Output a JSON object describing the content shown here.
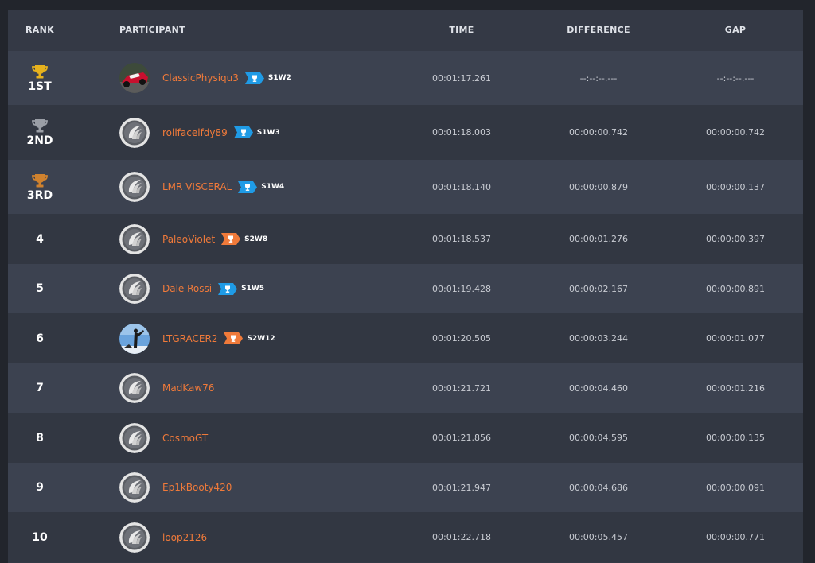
{
  "colors": {
    "accent_orange": "#f07a3a",
    "badge_blue": "#1f9be6",
    "badge_orange": "#f07a3a",
    "gold": "#e7b21d",
    "silver": "#9a9ea6",
    "bronze": "#d0822e"
  },
  "headers": {
    "rank": "RANK",
    "participant": "PARTICIPANT",
    "time": "TIME",
    "difference": "DIFFERENCE",
    "gap": "GAP"
  },
  "rows": [
    {
      "rank": "1ST",
      "trophy": "gold",
      "name": "ClassicPhysiqu3",
      "avatar": "race-car-avatar",
      "badge": "blue",
      "badge_label": "S1W2",
      "time": "00:01:17.261",
      "difference": "--:--:--.---",
      "gap": "--:--:--.---"
    },
    {
      "rank": "2ND",
      "trophy": "silver",
      "name": "rollfacelfdy89",
      "avatar": "default-avatar",
      "badge": "blue",
      "badge_label": "S1W3",
      "time": "00:01:18.003",
      "difference": "00:00:00.742",
      "gap": "00:00:00.742"
    },
    {
      "rank": "3RD",
      "trophy": "bronze",
      "name": "LMR VISCERAL",
      "avatar": "default-avatar",
      "badge": "blue",
      "badge_label": "S1W4",
      "time": "00:01:18.140",
      "difference": "00:00:00.879",
      "gap": "00:00:00.137"
    },
    {
      "rank": "4",
      "trophy": null,
      "name": "PaleoViolet",
      "avatar": "default-avatar",
      "badge": "orange",
      "badge_label": "S2W8",
      "time": "00:01:18.537",
      "difference": "00:00:01.276",
      "gap": "00:00:00.397"
    },
    {
      "rank": "5",
      "trophy": null,
      "name": "Dale Rossi",
      "avatar": "default-avatar",
      "badge": "blue",
      "badge_label": "S1W5",
      "time": "00:01:19.428",
      "difference": "00:00:02.167",
      "gap": "00:00:00.891"
    },
    {
      "rank": "6",
      "trophy": null,
      "name": "LTGRACER2",
      "avatar": "photo-avatar",
      "badge": "orange",
      "badge_label": "S2W12",
      "time": "00:01:20.505",
      "difference": "00:00:03.244",
      "gap": "00:00:01.077"
    },
    {
      "rank": "7",
      "trophy": null,
      "name": "MadKaw76",
      "avatar": "default-avatar",
      "badge": null,
      "badge_label": "",
      "time": "00:01:21.721",
      "difference": "00:00:04.460",
      "gap": "00:00:01.216"
    },
    {
      "rank": "8",
      "trophy": null,
      "name": "CosmoGT",
      "avatar": "default-avatar",
      "badge": null,
      "badge_label": "",
      "time": "00:01:21.856",
      "difference": "00:00:04.595",
      "gap": "00:00:00.135"
    },
    {
      "rank": "9",
      "trophy": null,
      "name": "Ep1kBooty420",
      "avatar": "default-avatar",
      "badge": null,
      "badge_label": "",
      "time": "00:01:21.947",
      "difference": "00:00:04.686",
      "gap": "00:00:00.091"
    },
    {
      "rank": "10",
      "trophy": null,
      "name": "loop2126",
      "avatar": "default-avatar",
      "badge": null,
      "badge_label": "",
      "time": "00:01:22.718",
      "difference": "00:00:05.457",
      "gap": "00:00:00.771"
    }
  ]
}
